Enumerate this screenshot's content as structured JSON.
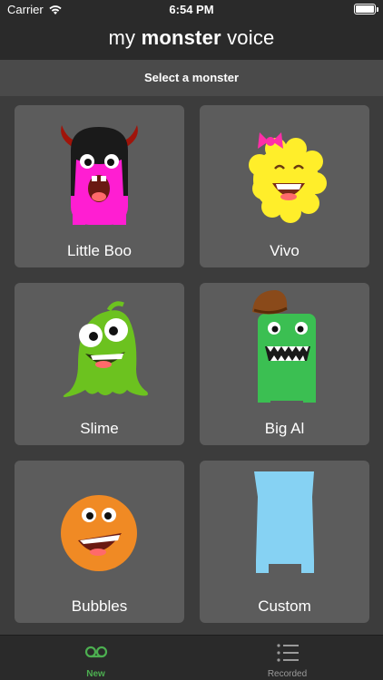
{
  "status": {
    "carrier": "Carrier",
    "time": "6:54 PM"
  },
  "header": {
    "prefix": "my",
    "strong": "monster",
    "suffix": "voice"
  },
  "subheader": "Select a monster",
  "monsters": [
    {
      "label": "Little Boo",
      "color": "#ff1ed2"
    },
    {
      "label": "Vivo",
      "color": "#ffee2a"
    },
    {
      "label": "Slime",
      "color": "#6cc21f"
    },
    {
      "label": "Big Al",
      "color": "#3bbf52"
    },
    {
      "label": "Bubbles",
      "color": "#f08a24"
    },
    {
      "label": "Custom",
      "color": "#86d2f3"
    }
  ],
  "tabs": [
    {
      "label": "New",
      "icon": "voicemail-icon",
      "active": true
    },
    {
      "label": "Recorded",
      "icon": "list-icon",
      "active": false
    }
  ],
  "colors": {
    "accent": "#4caf50",
    "tile": "#5c5c5c",
    "background": "#3c3c3c",
    "bar": "#2a2a2a"
  }
}
